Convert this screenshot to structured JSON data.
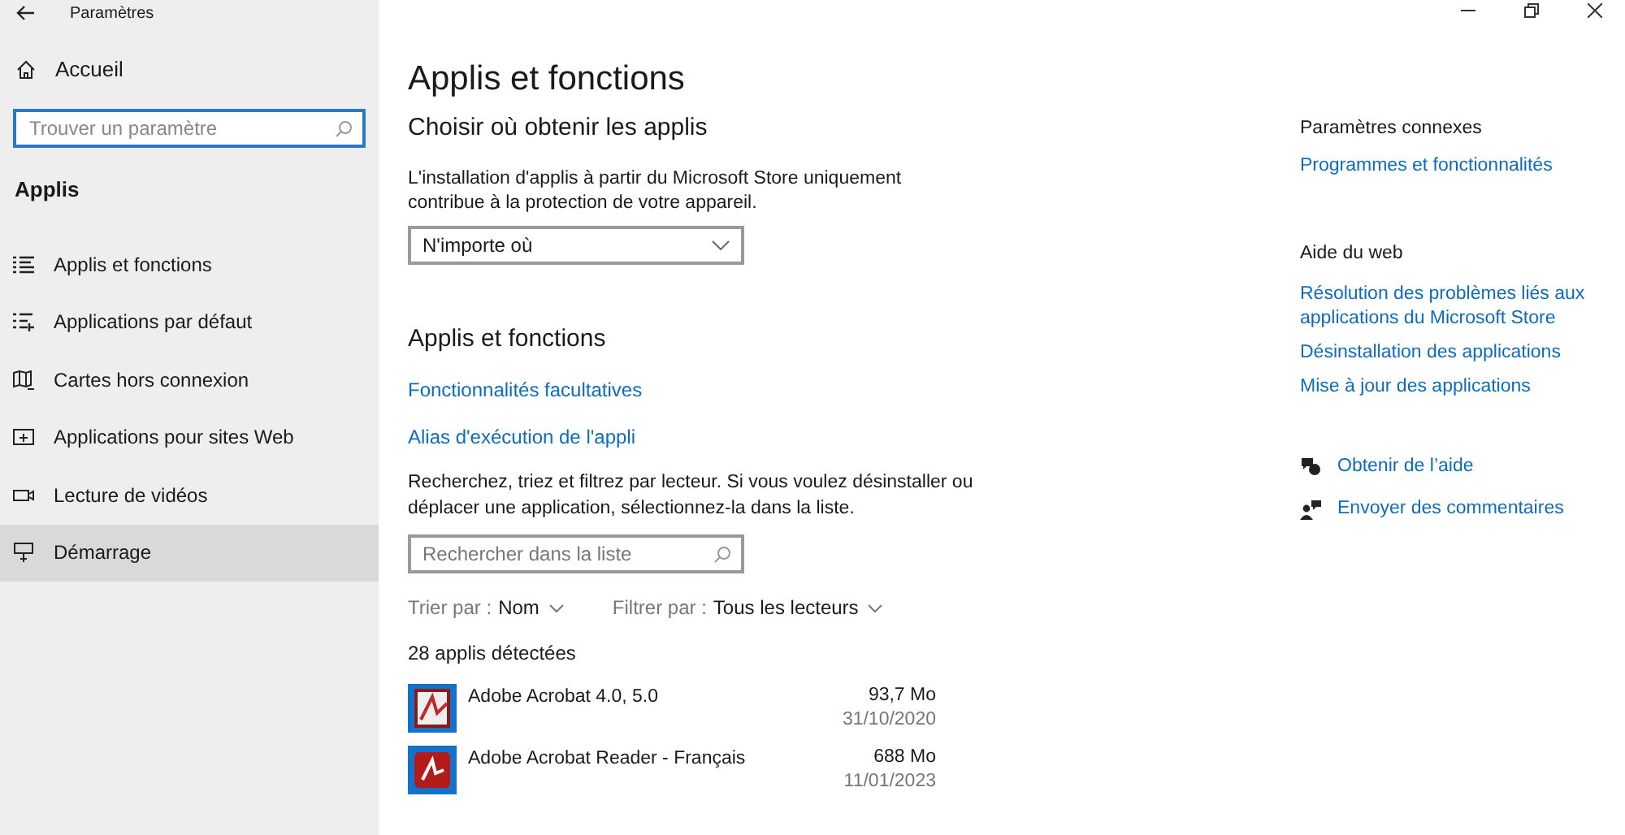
{
  "window": {
    "title": "Paramètres"
  },
  "sidebar": {
    "home": "Accueil",
    "search": {
      "placeholder": "Trouver un paramètre"
    },
    "section": "Applis",
    "items": [
      {
        "label": "Applis et fonctions",
        "selected": false
      },
      {
        "label": "Applications par défaut",
        "selected": false
      },
      {
        "label": "Cartes hors connexion",
        "selected": false
      },
      {
        "label": "Applications pour sites Web",
        "selected": false
      },
      {
        "label": "Lecture de vidéos",
        "selected": false
      },
      {
        "label": "Démarrage",
        "selected": true
      }
    ]
  },
  "main": {
    "title": "Applis et fonctions",
    "source_heading": "Choisir où obtenir les applis",
    "source_text": "L'installation d'applis à partir du Microsoft Store uniquement contribue à la protection de votre appareil.",
    "source_value": "N'importe où",
    "apps_heading": "Applis et fonctions",
    "links": [
      "Fonctionnalités facultatives",
      "Alias d'exécution de l'appli"
    ],
    "apps_text": "Recherchez, triez et filtrez par lecteur. Si vous voulez désinstaller ou déplacer une application, sélectionnez-la dans la liste.",
    "list_search": {
      "placeholder": "Rechercher dans la liste"
    },
    "sort": {
      "label": "Trier par :",
      "value": "Nom"
    },
    "filter": {
      "label": "Filtrer par :",
      "value": "Tous les lecteurs"
    },
    "count": "28 applis détectées",
    "apps": [
      {
        "name": "Adobe Acrobat 4.0, 5.0",
        "size": "93,7 Mo",
        "date": "31/10/2020"
      },
      {
        "name": "Adobe Acrobat Reader - Français",
        "size": "688 Mo",
        "date": "11/01/2023"
      }
    ]
  },
  "related": {
    "heading": "Paramètres connexes",
    "links": [
      "Programmes et fonctionnalités"
    ]
  },
  "web_help": {
    "heading": "Aide du web",
    "links": [
      "Résolution des problèmes liés aux applications du Microsoft Store",
      "Désinstallation des applications",
      "Mise à jour des applications"
    ]
  },
  "support": [
    "Obtenir de l’aide",
    "Envoyer des commentaires"
  ]
}
